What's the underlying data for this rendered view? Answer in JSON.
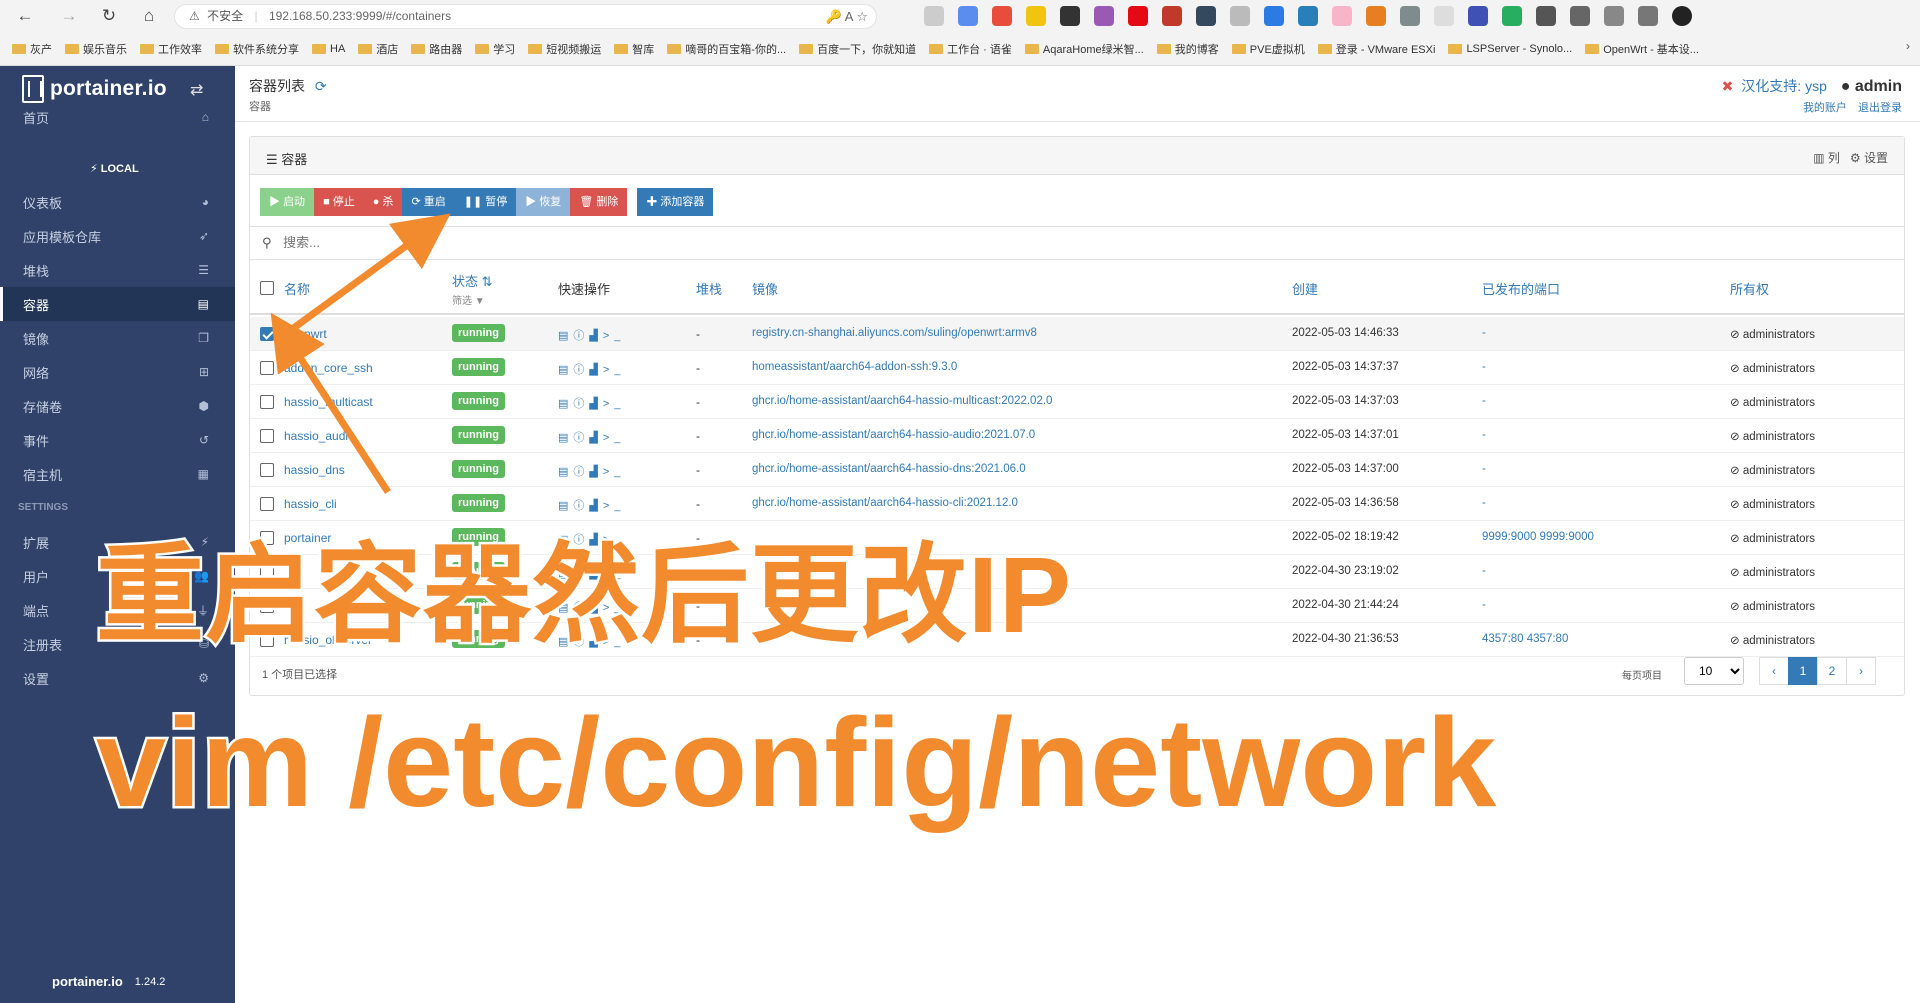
{
  "browser": {
    "security": "不安全",
    "url": "192.168.50.233:9999/#/containers",
    "bookmarks": [
      "灰产",
      "娱乐音乐",
      "工作效率",
      "软件系统分享",
      "HA",
      "酒店",
      "路由器",
      "学习",
      "短视频搬运",
      "智库",
      "嘀哥的百宝箱-你的...",
      "百度一下，你就知道",
      "工作台 · 语雀",
      "AqaraHome绿米智...",
      "我的博客",
      "PVE虚拟机",
      "登录 - VMware ESXi",
      "LSPServer - Synolo...",
      "OpenWrt - 基本设..."
    ]
  },
  "sidebar": {
    "brand": "portainer.io",
    "home": "首页",
    "endpoint": "LOCAL",
    "items": [
      {
        "label": "仪表板",
        "icon": "tachometer-icon"
      },
      {
        "label": "应用模板仓库",
        "icon": "rocket-icon"
      },
      {
        "label": "堆栈",
        "icon": "th-list-icon"
      },
      {
        "label": "容器",
        "icon": "server-icon",
        "active": true
      },
      {
        "label": "镜像",
        "icon": "clone-icon"
      },
      {
        "label": "网络",
        "icon": "sitemap-icon"
      },
      {
        "label": "存储卷",
        "icon": "cubes-icon"
      },
      {
        "label": "事件",
        "icon": "history-icon"
      },
      {
        "label": "宿主机",
        "icon": "th-icon"
      }
    ],
    "settings_label": "SETTINGS",
    "settings_items": [
      {
        "label": "扩展",
        "icon": "bolt-icon"
      },
      {
        "label": "用户",
        "icon": "users-icon"
      },
      {
        "label": "端点",
        "icon": "plug-icon"
      },
      {
        "label": "注册表",
        "icon": "database-icon"
      },
      {
        "label": "设置",
        "icon": "cogs-icon"
      }
    ],
    "footer_brand": "portainer.io",
    "version": "1.24.2"
  },
  "header": {
    "title": "容器列表",
    "breadcrumb": "容器",
    "support": "汉化支持: ysp",
    "user": "admin",
    "my_account": "我的账户",
    "logout": "退出登录"
  },
  "panel": {
    "title": "容器",
    "columns_label": "列",
    "settings_label": "设置",
    "actions": {
      "start": "启动",
      "stop": "停止",
      "kill": "杀",
      "restart": "重启",
      "pause": "暂停",
      "resume": "恢复",
      "remove": "删除",
      "add": "添加容器"
    },
    "search_placeholder": "搜索...",
    "headers": {
      "name": "名称",
      "state": "状态",
      "filter": "筛选",
      "quick": "快速操作",
      "stack": "堆栈",
      "image": "镜像",
      "created": "创建",
      "ports": "已发布的端口",
      "ownership": "所有权"
    },
    "rows": [
      {
        "name": "openwrt",
        "state": "running",
        "stack": "-",
        "image": "registry.cn-shanghai.aliyuncs.com/suling/openwrt:armv8",
        "created": "2022-05-03 14:46:33",
        "ports": "-",
        "owner": "administrators",
        "selected": true
      },
      {
        "name": "addon_core_ssh",
        "state": "running",
        "stack": "-",
        "image": "homeassistant/aarch64-addon-ssh:9.3.0",
        "created": "2022-05-03 14:37:37",
        "ports": "-",
        "owner": "administrators"
      },
      {
        "name": "hassio_multicast",
        "state": "running",
        "stack": "-",
        "image": "ghcr.io/home-assistant/aarch64-hassio-multicast:2022.02.0",
        "created": "2022-05-03 14:37:03",
        "ports": "-",
        "owner": "administrators"
      },
      {
        "name": "hassio_audio",
        "state": "running",
        "stack": "-",
        "image": "ghcr.io/home-assistant/aarch64-hassio-audio:2021.07.0",
        "created": "2022-05-03 14:37:01",
        "ports": "-",
        "owner": "administrators"
      },
      {
        "name": "hassio_dns",
        "state": "running",
        "stack": "-",
        "image": "ghcr.io/home-assistant/aarch64-hassio-dns:2021.06.0",
        "created": "2022-05-03 14:37:00",
        "ports": "-",
        "owner": "administrators"
      },
      {
        "name": "hassio_cli",
        "state": "running",
        "stack": "-",
        "image": "ghcr.io/home-assistant/aarch64-hassio-cli:2021.12.0",
        "created": "2022-05-03 14:36:58",
        "ports": "-",
        "owner": "administrators"
      },
      {
        "name": "portainer",
        "state": "running",
        "stack": "-",
        "image": "",
        "created": "2022-05-02 18:19:42",
        "ports": "9999:9000  9999:9000",
        "owner": "administrators"
      },
      {
        "name": "",
        "state": "running",
        "stack": "-",
        "image": "",
        "created": "2022-04-30 23:19:02",
        "ports": "-",
        "owner": "administrators"
      },
      {
        "name": "",
        "state": "running",
        "stack": "-",
        "image": "",
        "created": "2022-04-30 21:44:24",
        "ports": "-",
        "owner": "administrators"
      },
      {
        "name": "hassio_observer",
        "state": "running",
        "stack": "-",
        "image": "",
        "created": "2022-04-30 21:36:53",
        "ports": "4357:80  4357:80",
        "owner": "administrators"
      }
    ],
    "selected_count": "1 个项目已选择",
    "per_page_label": "每页项目",
    "per_page_value": "10",
    "pages": [
      "‹",
      "1",
      "2",
      "›"
    ]
  },
  "overlay": {
    "line1": "重启容器然后更改IP",
    "line2": "vim /etc/config/network",
    "color": "#f28a2e"
  }
}
